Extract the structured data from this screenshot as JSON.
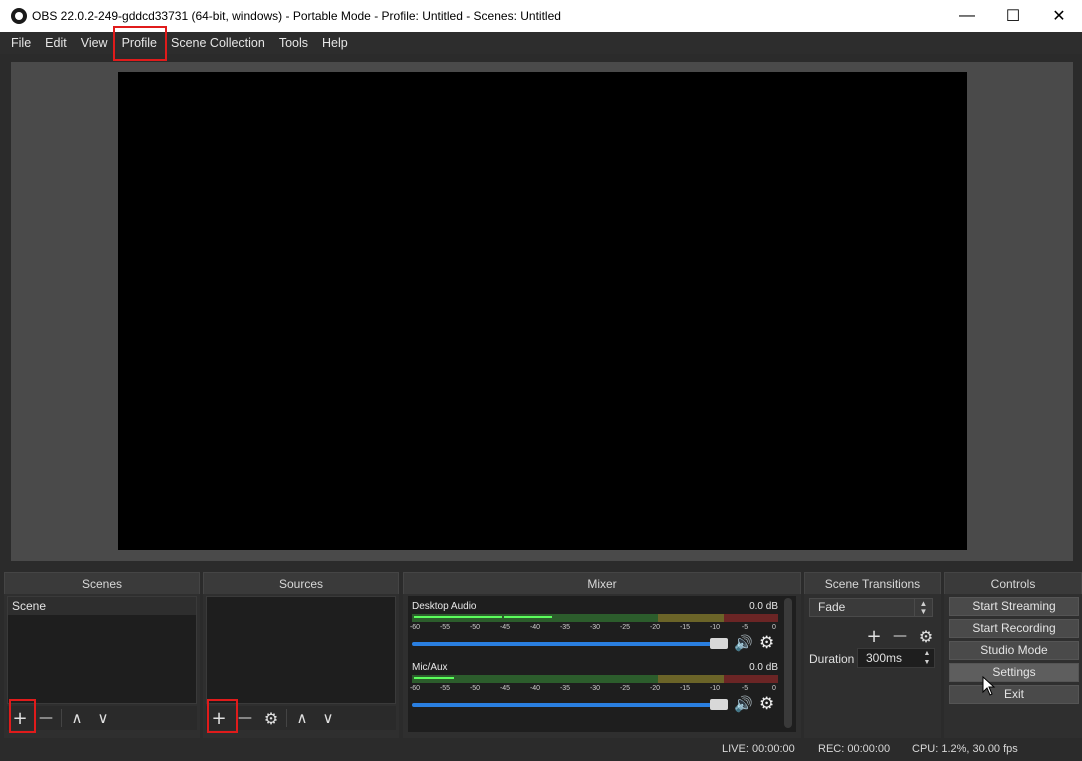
{
  "window": {
    "title": "OBS 22.0.2-249-gddcd33731 (64-bit, windows) - Portable Mode - Profile: Untitled - Scenes: Untitled",
    "minimize": "—",
    "maximize": "☐",
    "close": "✕"
  },
  "menu": [
    "File",
    "Edit",
    "View",
    "Profile",
    "Scene Collection",
    "Tools",
    "Help"
  ],
  "docks": {
    "scenes": {
      "title": "Scenes",
      "items": [
        "Scene"
      ]
    },
    "sources": {
      "title": "Sources"
    },
    "mixer": {
      "title": "Mixer",
      "channels": [
        {
          "name": "Desktop Audio",
          "db": "0.0 dB"
        },
        {
          "name": "Mic/Aux",
          "db": "0.0 dB"
        }
      ],
      "ticks": [
        "-60",
        "-55",
        "-50",
        "-45",
        "-40",
        "-35",
        "-30",
        "-25",
        "-20",
        "-15",
        "-10",
        "-5",
        "0"
      ]
    },
    "transitions": {
      "title": "Scene Transitions",
      "selected": "Fade",
      "duration_label": "Duration",
      "duration_value": "300ms"
    },
    "controls": {
      "title": "Controls",
      "buttons": [
        "Start Streaming",
        "Start Recording",
        "Studio Mode",
        "Settings",
        "Exit"
      ]
    }
  },
  "status": {
    "live": "LIVE: 00:00:00",
    "rec": "REC: 00:00:00",
    "cpu": "CPU: 1.2%, 30.00 fps"
  },
  "icons": {
    "add": "+",
    "remove": "—",
    "up": "∧",
    "down": "∨",
    "gear": "⚙",
    "speaker": "🔊"
  },
  "colors": {
    "highlight": "#e01b1b",
    "volume": "#2a7fe0"
  }
}
